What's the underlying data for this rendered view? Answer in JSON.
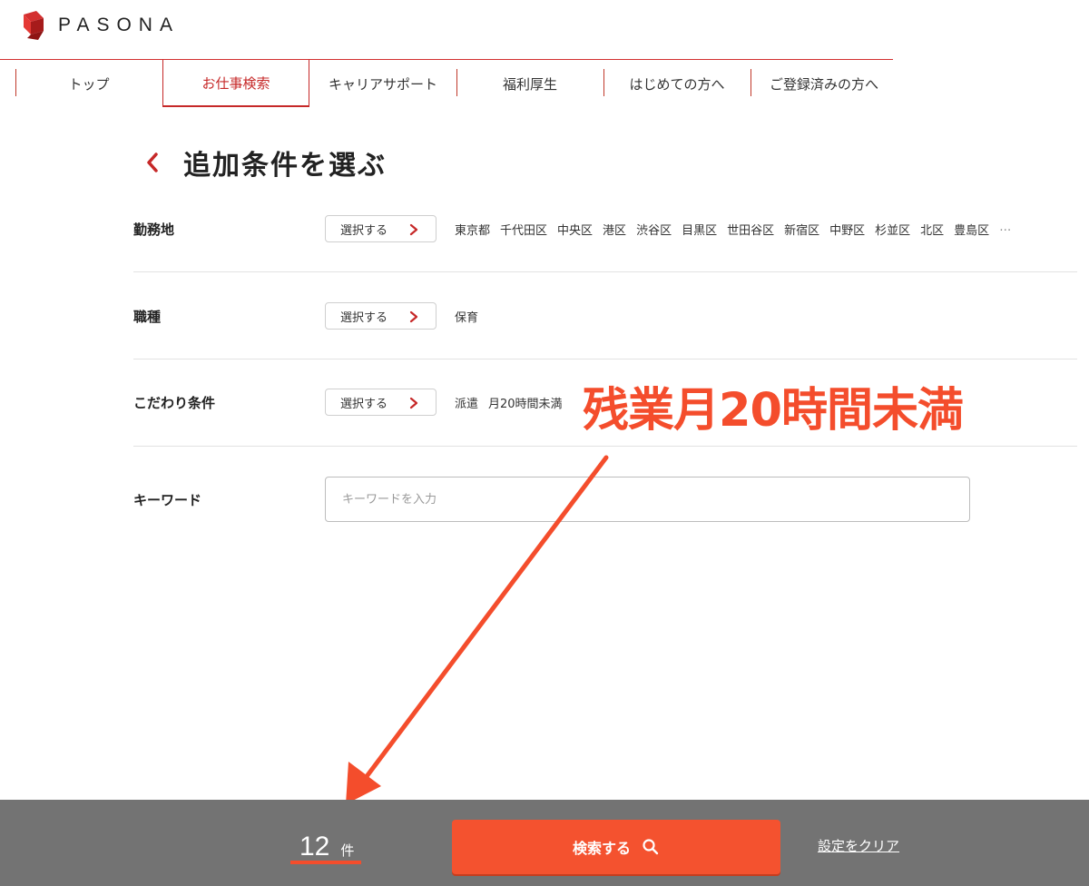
{
  "brand": {
    "name": "PASONA",
    "accent": "#c62828"
  },
  "nav": {
    "items": [
      {
        "label": "トップ"
      },
      {
        "label": "お仕事検索",
        "active": true
      },
      {
        "label": "キャリアサポート"
      },
      {
        "label": "福利厚生"
      },
      {
        "label": "はじめての方へ"
      },
      {
        "label": "ご登録済みの方へ"
      }
    ]
  },
  "page": {
    "title": "追加条件を選ぶ"
  },
  "conditions": {
    "location": {
      "label": "勤務地",
      "button": "選択する",
      "values": [
        "東京都",
        "千代田区",
        "中央区",
        "港区",
        "渋谷区",
        "目黒区",
        "世田谷区",
        "新宿区",
        "中野区",
        "杉並区",
        "北区",
        "豊島区",
        "…"
      ]
    },
    "job_type": {
      "label": "職種",
      "button": "選択する",
      "values": [
        "保育"
      ]
    },
    "preferences": {
      "label": "こだわり条件",
      "button": "選択する",
      "values": [
        "派遣",
        "月20時間未満"
      ]
    },
    "keyword": {
      "label": "キーワード",
      "placeholder": "キーワードを入力",
      "value": ""
    }
  },
  "annotation": {
    "text": "残業月20時間未満",
    "color": "#f44d2c"
  },
  "footer": {
    "count": "12",
    "count_unit": "件",
    "search_label": "検索する",
    "clear_label": "設定をクリア",
    "button_color": "#f4522f"
  }
}
